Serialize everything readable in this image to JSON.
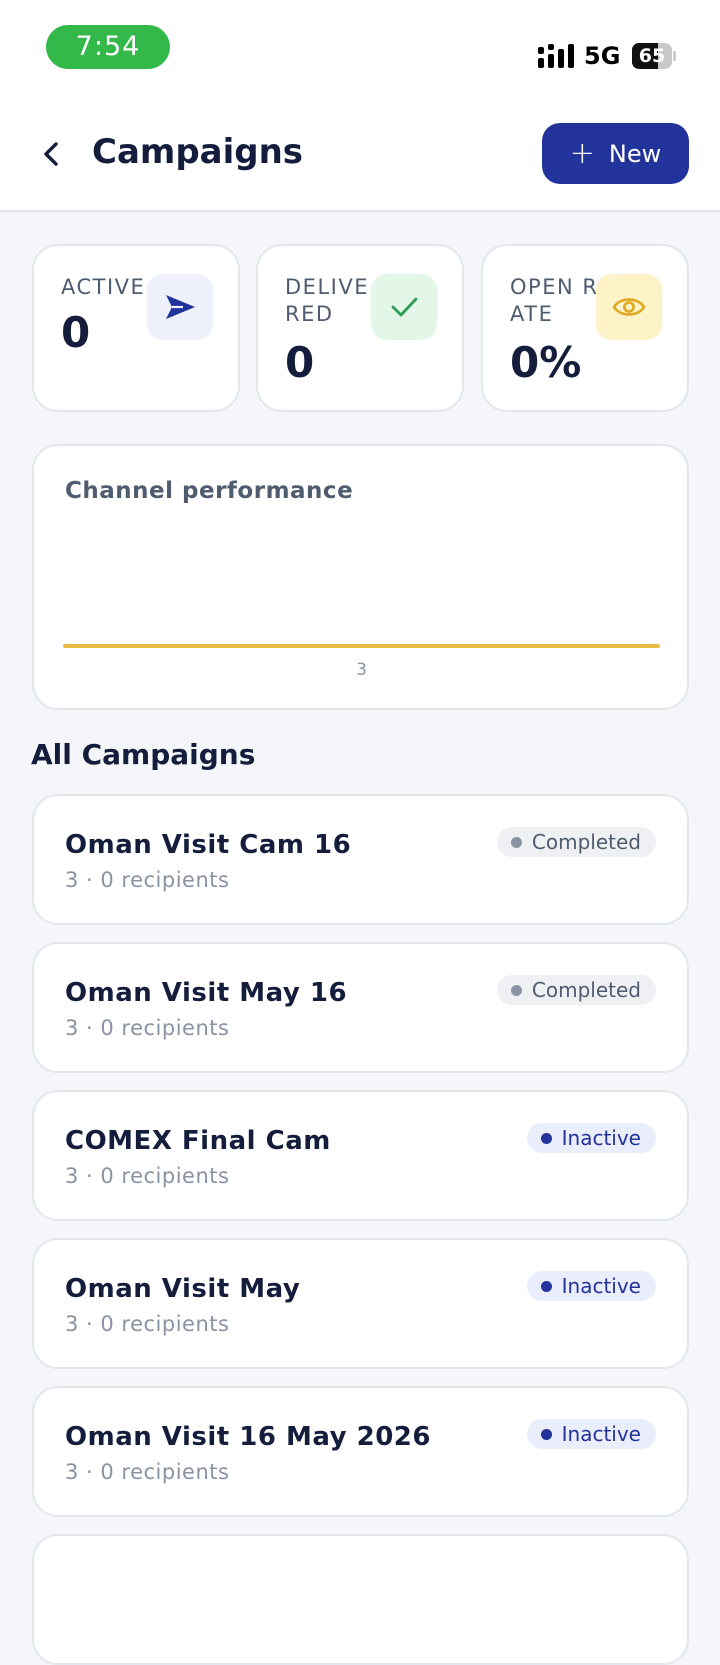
{
  "status_bar": {
    "time": "7:54",
    "network": "5G",
    "battery": "65",
    "battery_level": 0.65
  },
  "header": {
    "title": "Campaigns",
    "new_label": "New"
  },
  "stats": [
    {
      "label": "ACTIVE",
      "value": "0",
      "icon": "send-icon",
      "icon_bg": "#eef0fb",
      "icon_color": "#22349b"
    },
    {
      "label": "DELIVERED",
      "value": "0",
      "icon": "check-icon",
      "icon_bg": "#e2f7e8",
      "icon_color": "#2e9b57"
    },
    {
      "label": "OPEN RATE",
      "value": "0%",
      "icon": "eye-icon",
      "icon_bg": "#fdf2c8",
      "icon_color": "#e1a81f"
    }
  ],
  "performance": {
    "title": "Channel performance",
    "chart_data": {
      "type": "line",
      "x": [
        "3"
      ],
      "series": [
        {
          "values": [
            0
          ],
          "color": "#e9bb43"
        }
      ]
    }
  },
  "section_title": "All Campaigns",
  "campaigns": [
    {
      "name": "Oman Visit Cam 16",
      "meta": "3 · 0 recipients",
      "status": "Completed",
      "status_type": "completed"
    },
    {
      "name": "Oman Visit May 16",
      "meta": "3 · 0 recipients",
      "status": "Completed",
      "status_type": "completed"
    },
    {
      "name": "COMEX Final Cam",
      "meta": "3 · 0 recipients",
      "status": "Inactive",
      "status_type": "inactive"
    },
    {
      "name": "Oman Visit May",
      "meta": "3 · 0 recipients",
      "status": "Inactive",
      "status_type": "inactive"
    },
    {
      "name": "Oman Visit 16 May 2026",
      "meta": "3 · 0 recipients",
      "status": "Inactive",
      "status_type": "inactive"
    }
  ]
}
